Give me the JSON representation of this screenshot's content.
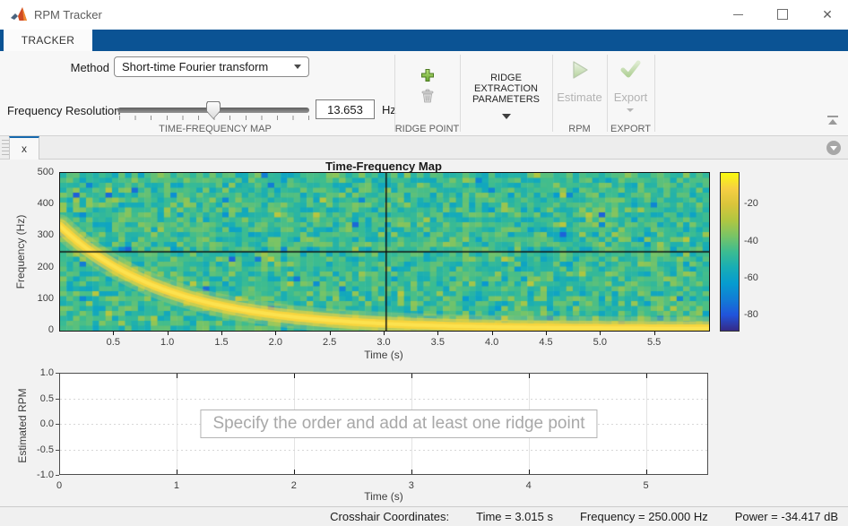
{
  "window": {
    "title": "RPM Tracker"
  },
  "ribbon": {
    "tab_label": "TRACKER",
    "method_label": "Method",
    "method_value": "Short-time Fourier transform",
    "freq_res_label": "Frequency Resolution",
    "freq_res_value": "13.653",
    "freq_res_unit": "Hz",
    "slider_fraction": 0.5,
    "section_tfm": "TIME-FREQUENCY MAP",
    "section_ridge_point": "RIDGE POINT",
    "ridge_extraction_lines": [
      "RIDGE",
      "EXTRACTION",
      "PARAMETERS"
    ],
    "estimate_label": "Estimate",
    "section_rpm": "RPM",
    "export_label": "Export",
    "section_export": "EXPORT"
  },
  "doc_tab_label": "x",
  "icons": {
    "app": "matlab-logo-icon",
    "add_ridge_point": "plus-icon",
    "delete_ridge_point": "trash-icon",
    "estimate": "play-icon",
    "export": "check-icon",
    "tab_options": "circle-down-arrow-icon",
    "collapse_ribbon": "collapse-up-icon"
  },
  "colors": {
    "ribbon_blue": "#0b5394",
    "active_tab_border": "#1668ad",
    "plus_green": "#6aa72e",
    "disabled_gray": "#b3b3b3"
  },
  "status": {
    "crosshair_prefix": "Crosshair Coordinates:",
    "time": "Time = 3.015 s",
    "frequency": "Frequency = 250.000 Hz",
    "power": "Power = -34.417 dB"
  },
  "chart_data": [
    {
      "type": "heatmap",
      "title": "Time-Frequency Map",
      "xlabel": "Time (s)",
      "ylabel": "Frequency (Hz)",
      "xlim": [
        0,
        6
      ],
      "ylim": [
        0,
        500
      ],
      "xticks": [
        {
          "v": 0.5,
          "label": "0.5"
        },
        {
          "v": 1.0,
          "label": "1.0"
        },
        {
          "v": 1.5,
          "label": "1.5"
        },
        {
          "v": 2.0,
          "label": "2.0"
        },
        {
          "v": 2.5,
          "label": "2.5"
        },
        {
          "v": 3.0,
          "label": "3.0"
        },
        {
          "v": 3.5,
          "label": "3.5"
        },
        {
          "v": 4.0,
          "label": "4.0"
        },
        {
          "v": 4.5,
          "label": "4.5"
        },
        {
          "v": 5.0,
          "label": "5.0"
        },
        {
          "v": 5.5,
          "label": "5.5"
        }
      ],
      "yticks": [
        {
          "v": 0,
          "label": "0"
        },
        {
          "v": 100,
          "label": "100"
        },
        {
          "v": 200,
          "label": "200"
        },
        {
          "v": 300,
          "label": "300"
        },
        {
          "v": 400,
          "label": "400"
        },
        {
          "v": 500,
          "label": "500"
        }
      ],
      "colormap": "parula",
      "colorbar": {
        "range_db": [
          -88,
          -3
        ],
        "ticks": [
          {
            "v": -20,
            "label": "-20"
          },
          {
            "v": -40,
            "label": "-40"
          },
          {
            "v": -60,
            "label": "-60"
          },
          {
            "v": -80,
            "label": "-80"
          }
        ]
      },
      "noise": {
        "mean_db": -46,
        "spread_db": 9
      },
      "ridge": {
        "kind": "exponential-decay-chirp",
        "f_start_hz": 326,
        "tau_s": 1.0,
        "f_floor_hz": 6
      },
      "crosshair": {
        "time_s": 3.015,
        "frequency_hz": 250
      }
    },
    {
      "type": "line",
      "title": "",
      "xlabel": "Time (s)",
      "ylabel": "Estimated RPM",
      "xlim": [
        0,
        5.53
      ],
      "ylim": [
        -1,
        1
      ],
      "xticks": [
        {
          "v": 0,
          "label": "0"
        },
        {
          "v": 1,
          "label": "1"
        },
        {
          "v": 2,
          "label": "2"
        },
        {
          "v": 3,
          "label": "3"
        },
        {
          "v": 4,
          "label": "4"
        },
        {
          "v": 5,
          "label": "5"
        }
      ],
      "yticks": [
        {
          "v": 1,
          "label": "1.0"
        },
        {
          "v": 0.5,
          "label": "0.5"
        },
        {
          "v": 0,
          "label": "0.0"
        },
        {
          "v": -0.5,
          "label": "-0.5"
        },
        {
          "v": -1,
          "label": "-1.0"
        }
      ],
      "grid_x": [
        1,
        2,
        3,
        4,
        5
      ],
      "grid_y": [
        0.5,
        0,
        -0.5
      ],
      "series": [],
      "message": "Specify the order and add at least one ridge point"
    }
  ]
}
